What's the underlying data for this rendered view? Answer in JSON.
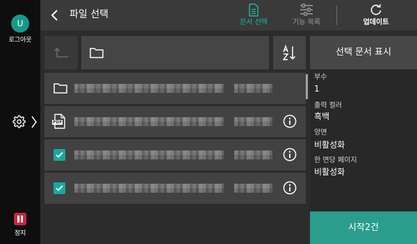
{
  "sidebar": {
    "avatar_letter": "U",
    "logout_label": "로그아웃",
    "settings_icon": "gear-icon",
    "stop_label": "정지"
  },
  "header": {
    "title": "파일 선택",
    "back_icon": "chevron-left-icon",
    "actions": [
      {
        "label": "문서 선택",
        "icon": "document-icon",
        "active": true
      },
      {
        "label": "기능 목록",
        "icon": "sliders-icon",
        "active": false
      },
      {
        "label": "업데이트",
        "icon": "refresh-icon",
        "active": false
      }
    ]
  },
  "path_bar": {
    "up_icon": "folder-up-icon",
    "up_enabled": false,
    "path_icon": "folder-icon",
    "sort_icon": "sort-az-icon",
    "show_selected_label": "선택 문서 표시"
  },
  "files": [
    {
      "icon": "folder-icon",
      "checked": false,
      "info": false
    },
    {
      "icon": "pdf-file-icon",
      "badge": "PDF",
      "checked": false,
      "info": true
    },
    {
      "icon": "checkbox-icon",
      "checked": true,
      "info": true
    },
    {
      "icon": "checkbox-icon",
      "checked": true,
      "info": true
    }
  ],
  "settings": [
    {
      "label": "부수",
      "value": "1"
    },
    {
      "label": "출력 컬러",
      "value": "흑백"
    },
    {
      "label": "양면",
      "value": "비활성화"
    },
    {
      "label": "한 면당 페이지",
      "value": "비활성화"
    }
  ],
  "start_button_label": "시작2건",
  "colors": {
    "accent": "#22b2a5",
    "checkbox": "#19a8a0",
    "avatar": "#17998a",
    "start": "#2a9d8c",
    "stop": "#c8283c"
  }
}
